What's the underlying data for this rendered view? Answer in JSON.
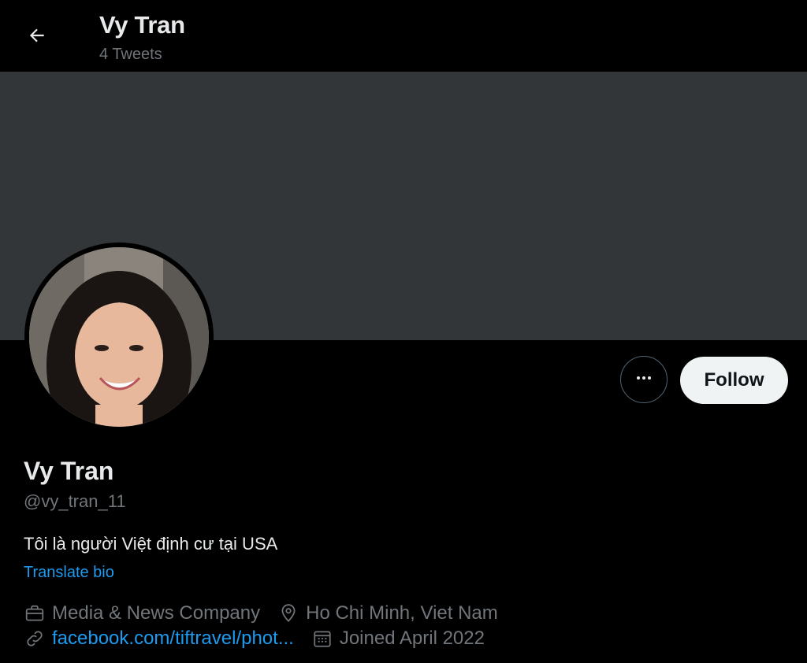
{
  "header": {
    "title": "Vy Tran",
    "tweet_count": "4 Tweets"
  },
  "profile": {
    "display_name": "Vy Tran",
    "handle": "@vy_tran_11",
    "bio": "Tôi là người Việt định cư tại USA",
    "translate_label": "Translate bio",
    "category": "Media & News Company",
    "location": "Ho Chi Minh, Viet Nam",
    "website": "facebook.com/tiftravel/phot...",
    "joined": "Joined April 2022"
  },
  "actions": {
    "follow_label": "Follow",
    "more_label": "More"
  },
  "icons": {
    "back": "arrow-left-icon",
    "more": "ellipsis-icon",
    "category": "briefcase-icon",
    "location": "map-pin-icon",
    "website": "link-icon",
    "joined": "calendar-icon"
  },
  "colors": {
    "background": "#000000",
    "banner": "#333639",
    "accent": "#1d9bf0",
    "text_primary": "#e7e9ea",
    "text_secondary": "#71767b",
    "follow_bg": "#eff3f4"
  }
}
